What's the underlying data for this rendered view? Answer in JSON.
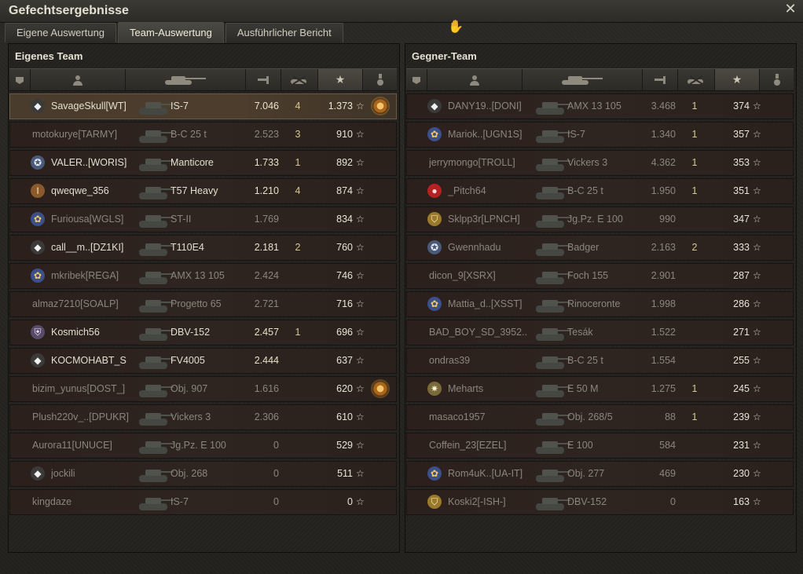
{
  "window": {
    "title": "Gefechtsergebnisse",
    "close_icon": "close-icon"
  },
  "tabs": [
    {
      "label": "Eigene Auswertung",
      "active": false
    },
    {
      "label": "Team-Auswertung",
      "active": true
    },
    {
      "label": "Ausführlicher Bericht",
      "active": false
    }
  ],
  "own_team": {
    "title": "Eigenes Team",
    "rows": [
      {
        "player": "SavageSkull[WT]",
        "tank": "IS-7",
        "xp": "7.046",
        "kills": "4",
        "score": "1.373",
        "badge": "diamond",
        "medal": true,
        "highlight": true,
        "dim": false
      },
      {
        "player": "motokurye[TARMY]",
        "tank": "B-C 25 t",
        "xp": "2.523",
        "kills": "3",
        "score": "910",
        "badge": "",
        "medal": false,
        "highlight": false,
        "dim": true
      },
      {
        "player": "VALER..[WORIS]",
        "tank": "Manticore",
        "xp": "1.733",
        "kills": "1",
        "score": "892",
        "badge": "wolf",
        "medal": false,
        "highlight": false,
        "dim": false
      },
      {
        "player": "qweqwe_356",
        "tank": "T57 Heavy",
        "xp": "1.210",
        "kills": "4",
        "score": "874",
        "badge": "roman",
        "medal": false,
        "highlight": false,
        "dim": false
      },
      {
        "player": "Furiousa[WGLS]",
        "tank": "ST-II",
        "xp": "1.769",
        "kills": "",
        "score": "834",
        "badge": "flower",
        "medal": false,
        "highlight": false,
        "dim": true
      },
      {
        "player": "call__m..[DZ1KI]",
        "tank": "T110E4",
        "xp": "2.181",
        "kills": "2",
        "score": "760",
        "badge": "diamond",
        "medal": false,
        "highlight": false,
        "dim": false
      },
      {
        "player": "mkribek[REGA]",
        "tank": "AMX 13 105",
        "xp": "2.424",
        "kills": "",
        "score": "746",
        "badge": "flower",
        "medal": false,
        "highlight": false,
        "dim": true
      },
      {
        "player": "almaz7210[SOALP]",
        "tank": "Progetto 65",
        "xp": "2.721",
        "kills": "",
        "score": "716",
        "badge": "",
        "medal": false,
        "highlight": false,
        "dim": true
      },
      {
        "player": "Kosmich56",
        "tank": "DBV-152",
        "xp": "2.457",
        "kills": "1",
        "score": "696",
        "badge": "shield",
        "medal": false,
        "highlight": false,
        "dim": false
      },
      {
        "player": "KOCMOHABT_S",
        "tank": "FV4005",
        "xp": "2.444",
        "kills": "",
        "score": "637",
        "badge": "diamond",
        "medal": false,
        "highlight": false,
        "dim": false
      },
      {
        "player": "bizim_yunus[DOST_]",
        "tank": "Obj. 907",
        "xp": "1.616",
        "kills": "",
        "score": "620",
        "badge": "",
        "medal": true,
        "highlight": false,
        "dim": true
      },
      {
        "player": "Plush220v_..[DPUKR]",
        "tank": "Vickers 3",
        "xp": "2.306",
        "kills": "",
        "score": "610",
        "badge": "",
        "medal": false,
        "highlight": false,
        "dim": true
      },
      {
        "player": "Aurora11[UNUCE]",
        "tank": "Jg.Pz. E 100",
        "xp": "0",
        "kills": "",
        "score": "529",
        "badge": "",
        "medal": false,
        "highlight": false,
        "dim": true
      },
      {
        "player": "jockili",
        "tank": "Obj. 268",
        "xp": "0",
        "kills": "",
        "score": "511",
        "badge": "diamond",
        "medal": false,
        "highlight": false,
        "dim": true
      },
      {
        "player": "kingdaze",
        "tank": "IS-7",
        "xp": "0",
        "kills": "",
        "score": "0",
        "badge": "",
        "medal": false,
        "highlight": false,
        "dim": true
      }
    ]
  },
  "enemy_team": {
    "title": "Gegner-Team",
    "rows": [
      {
        "player": "DANY19..[DONI]",
        "tank": "AMX 13 105",
        "xp": "3.468",
        "kills": "1",
        "score": "374",
        "badge": "diamond",
        "medal": false,
        "dim": true
      },
      {
        "player": "Mariok..[UGN1S]",
        "tank": "IS-7",
        "xp": "1.340",
        "kills": "1",
        "score": "357",
        "badge": "flower",
        "medal": false,
        "dim": true
      },
      {
        "player": "jerrymongo[TROLL]",
        "tank": "Vickers 3",
        "xp": "4.362",
        "kills": "1",
        "score": "353",
        "badge": "",
        "medal": false,
        "dim": true
      },
      {
        "player": "_Pitch64",
        "tank": "B-C 25 t",
        "xp": "1.950",
        "kills": "1",
        "score": "351",
        "badge": "red",
        "medal": false,
        "dim": true
      },
      {
        "player": "Sklpp3r[LPNCH]",
        "tank": "Jg.Pz. E 100",
        "xp": "990",
        "kills": "",
        "score": "347",
        "badge": "gold",
        "medal": false,
        "dim": true
      },
      {
        "player": "Gwennhadu",
        "tank": "Badger",
        "xp": "2.163",
        "kills": "2",
        "score": "333",
        "badge": "wolf",
        "medal": false,
        "dim": true
      },
      {
        "player": "dicon_9[XSRX]",
        "tank": "Foch 155",
        "xp": "2.901",
        "kills": "",
        "score": "287",
        "badge": "",
        "medal": false,
        "dim": true
      },
      {
        "player": "Mattia_d..[XSST]",
        "tank": "Rinoceronte",
        "xp": "1.998",
        "kills": "",
        "score": "286",
        "badge": "flower",
        "medal": false,
        "dim": true
      },
      {
        "player": "BAD_BOY_SD_3952..",
        "tank": "Tesák",
        "xp": "1.522",
        "kills": "",
        "score": "271",
        "badge": "",
        "medal": false,
        "dim": true
      },
      {
        "player": "ondras39",
        "tank": "B-C 25 t",
        "xp": "1.554",
        "kills": "",
        "score": "255",
        "badge": "",
        "medal": false,
        "dim": true
      },
      {
        "player": "Meharts",
        "tank": "E 50 M",
        "xp": "1.275",
        "kills": "1",
        "score": "245",
        "badge": "star",
        "medal": false,
        "dim": true
      },
      {
        "player": "masaco1957",
        "tank": "Obj. 268/5",
        "xp": "88",
        "kills": "1",
        "score": "239",
        "badge": "",
        "medal": false,
        "dim": true
      },
      {
        "player": "Coffein_23[EZEL]",
        "tank": "E 100",
        "xp": "584",
        "kills": "",
        "score": "231",
        "badge": "",
        "medal": false,
        "dim": true
      },
      {
        "player": "Rom4uK..[UA-IT]",
        "tank": "Obj. 277",
        "xp": "469",
        "kills": "",
        "score": "230",
        "badge": "flower",
        "medal": false,
        "dim": true
      },
      {
        "player": "Koski2[-ISH-]",
        "tank": "DBV-152",
        "xp": "0",
        "kills": "",
        "score": "163",
        "badge": "gold",
        "medal": false,
        "dim": true
      }
    ]
  },
  "columns": [
    "squad-icon",
    "player-icon",
    "tank-icon",
    "damage-icon",
    "kills-icon",
    "star-icon",
    "medal-icon"
  ],
  "colors": {
    "accent": "#e4e0d2",
    "row_highlight": "#4a3c2c",
    "row_bg": "#2b201c",
    "star": "#d8d4c6"
  }
}
